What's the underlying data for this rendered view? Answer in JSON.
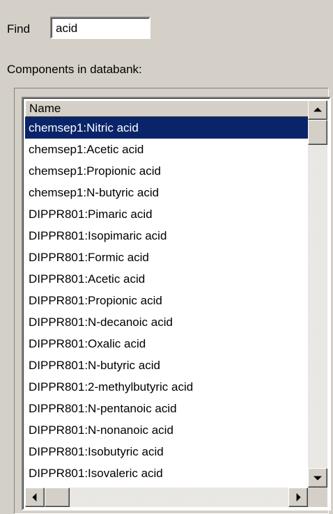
{
  "find": {
    "label": "Find",
    "value": "acid"
  },
  "components_label": "Components in databank:",
  "list": {
    "column_header": "Name",
    "selected_index": 0,
    "items": [
      "chemsep1:Nitric acid",
      "chemsep1:Acetic acid",
      "chemsep1:Propionic acid",
      "chemsep1:N-butyric acid",
      "DIPPR801:Pimaric acid",
      "DIPPR801:Isopimaric acid",
      "DIPPR801:Formic acid",
      "DIPPR801:Acetic acid",
      "DIPPR801:Propionic acid",
      "DIPPR801:N-decanoic acid",
      "DIPPR801:Oxalic acid",
      "DIPPR801:N-butyric acid",
      "DIPPR801:2-methylbutyric acid",
      "DIPPR801:N-pentanoic acid",
      "DIPPR801:N-nonanoic acid",
      "DIPPR801:Isobutyric acid",
      "DIPPR801:Isovaleric acid"
    ]
  },
  "icons": {
    "scroll_up": "arrow-up-icon",
    "scroll_down": "arrow-down-icon",
    "scroll_left": "arrow-left-icon",
    "scroll_right": "arrow-right-icon"
  },
  "colors": {
    "selection": "#0a246a",
    "face": "#d4d0c8"
  }
}
